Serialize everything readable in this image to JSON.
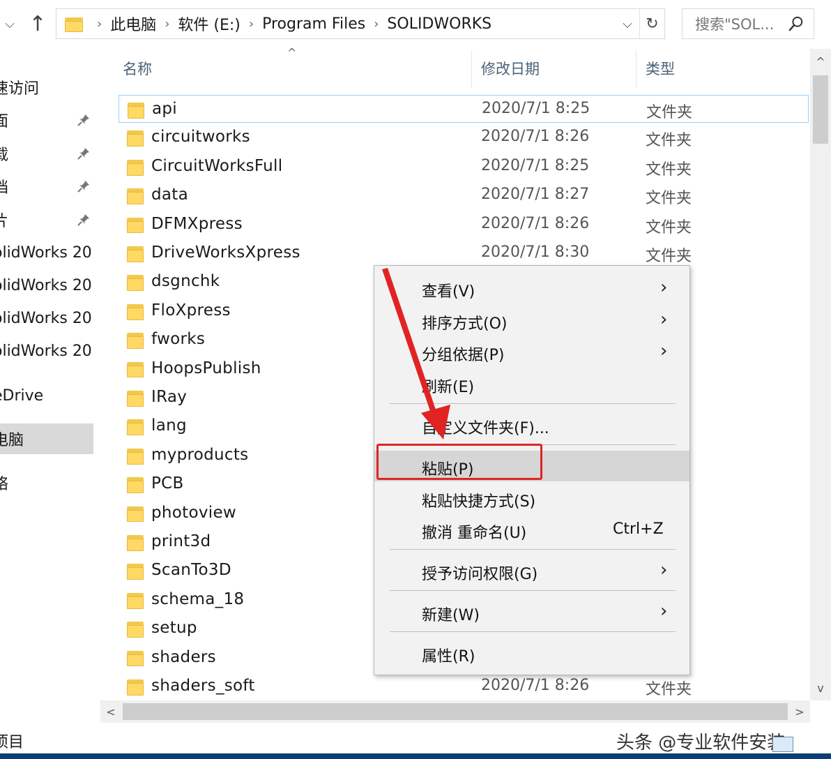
{
  "toolbar": {
    "dropdown_glyph": "⌵",
    "up_glyph": "↑"
  },
  "address": {
    "crumbs": [
      "此电脑",
      "软件 (E:)",
      "Program Files",
      "SOLIDWORKS"
    ],
    "separator": "›",
    "dropdown_glyph": "⌵",
    "refresh_glyph": "↻"
  },
  "search": {
    "placeholder": "搜索\"SOL..."
  },
  "navpane": {
    "items": [
      {
        "label": "速访问",
        "pinned": false
      },
      {
        "label": "面",
        "pinned": true
      },
      {
        "label": "载",
        "pinned": true
      },
      {
        "label": "档",
        "pinned": true
      },
      {
        "label": "片",
        "pinned": true
      },
      {
        "label": "olidWorks 20",
        "pinned": false
      },
      {
        "label": "olidWorks 20",
        "pinned": false
      },
      {
        "label": "olidWorks 20",
        "pinned": false
      },
      {
        "label": "olidWorks 20",
        "pinned": false
      },
      {
        "label": "eDrive",
        "pinned": false
      },
      {
        "label": "电脑",
        "pinned": false,
        "selected": true
      },
      {
        "label": "络",
        "pinned": false
      }
    ]
  },
  "columns": {
    "name": "名称",
    "date": "修改日期",
    "type": "类型",
    "sort_glyph": "^"
  },
  "files": [
    {
      "name": "api",
      "date": "2020/7/1 8:25",
      "type": "文件夹"
    },
    {
      "name": "circuitworks",
      "date": "2020/7/1 8:26",
      "type": "文件夹"
    },
    {
      "name": "CircuitWorksFull",
      "date": "2020/7/1 8:25",
      "type": "文件夹"
    },
    {
      "name": "data",
      "date": "2020/7/1 8:27",
      "type": "文件夹"
    },
    {
      "name": "DFMXpress",
      "date": "2020/7/1 8:26",
      "type": "文件夹"
    },
    {
      "name": "DriveWorksXpress",
      "date": "2020/7/1 8:30",
      "type": "文件夹"
    },
    {
      "name": "dsgnchk",
      "date": "",
      "type": ""
    },
    {
      "name": "FloXpress",
      "date": "",
      "type": ""
    },
    {
      "name": "fworks",
      "date": "",
      "type": ""
    },
    {
      "name": "HoopsPublish",
      "date": "",
      "type": ""
    },
    {
      "name": "IRay",
      "date": "",
      "type": ""
    },
    {
      "name": "lang",
      "date": "",
      "type": ""
    },
    {
      "name": "myproducts",
      "date": "",
      "type": ""
    },
    {
      "name": "PCB",
      "date": "",
      "type": ""
    },
    {
      "name": "photoview",
      "date": "",
      "type": ""
    },
    {
      "name": "print3d",
      "date": "",
      "type": ""
    },
    {
      "name": "ScanTo3D",
      "date": "",
      "type": ""
    },
    {
      "name": "schema_18",
      "date": "",
      "type": ""
    },
    {
      "name": "setup",
      "date": "",
      "type": ""
    },
    {
      "name": "shaders",
      "date": "",
      "type": ""
    },
    {
      "name": "shaders_soft",
      "date": "2020/7/1 8:26",
      "type": "文件夹"
    }
  ],
  "context_menu": {
    "items": [
      {
        "label": "查看(V)",
        "submenu": true
      },
      {
        "label": "排序方式(O)",
        "submenu": true
      },
      {
        "label": "分组依据(P)",
        "submenu": true
      },
      {
        "label": "刷新(E)",
        "submenu": false
      },
      {
        "label": "自定义文件夹(F)...",
        "submenu": false
      },
      {
        "label": "粘贴(P)",
        "submenu": false,
        "highlighted": true
      },
      {
        "label": "粘贴快捷方式(S)",
        "submenu": false
      },
      {
        "label": "撤消 重命名(U)",
        "submenu": false,
        "shortcut": "Ctrl+Z"
      },
      {
        "label": "授予访问权限(G)",
        "submenu": true
      },
      {
        "label": "新建(W)",
        "submenu": true
      },
      {
        "label": "属性(R)",
        "submenu": false
      }
    ],
    "submenu_glyph": "›"
  },
  "scroll": {
    "up": "^",
    "down": "v",
    "left": "<",
    "right": ">"
  },
  "status": {
    "text": "项目"
  },
  "watermark": "头条 @专业软件安装",
  "colors": {
    "accent_red": "#e02424",
    "selection_border": "#99d1ff",
    "folder_yellow": "#ffd964"
  }
}
